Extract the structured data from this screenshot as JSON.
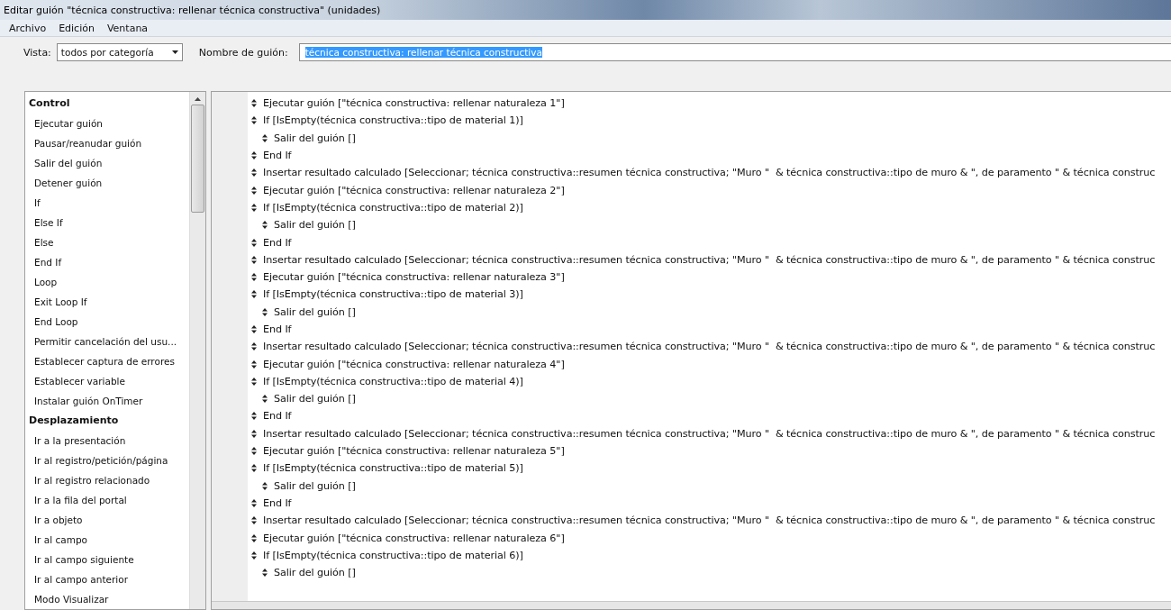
{
  "window": {
    "title": "Editar guión \"técnica constructiva: rellenar técnica constructiva\" (unidades)"
  },
  "menu": [
    "Archivo",
    "Edición",
    "Ventana"
  ],
  "view": {
    "label": "Vista:",
    "value": "todos por categoría"
  },
  "script_name": {
    "label": "Nombre de guión:",
    "value": "técnica constructiva: rellenar técnica constructiva",
    "selected": true
  },
  "steps_list": [
    {
      "label": "Control",
      "children": [
        {
          "label": "Ejecutar guión"
        },
        {
          "label": "Pausar/reanudar guión"
        },
        {
          "label": "Salir del guión"
        },
        {
          "label": "Detener guión"
        },
        {
          "label": "If"
        },
        {
          "label": "Else If"
        },
        {
          "label": "Else"
        },
        {
          "label": "End If"
        },
        {
          "label": "Loop"
        },
        {
          "label": "Exit Loop If"
        },
        {
          "label": "End Loop"
        },
        {
          "label": "Permitir cancelación del usu..."
        },
        {
          "label": "Establecer captura de errores"
        },
        {
          "label": "Establecer variable"
        },
        {
          "label": "Instalar guión OnTimer"
        }
      ]
    },
    {
      "label": "Desplazamiento",
      "children": [
        {
          "label": "Ir a la presentación"
        },
        {
          "label": "Ir al registro/petición/página"
        },
        {
          "label": "Ir al registro relacionado"
        },
        {
          "label": "Ir a la fila del portal"
        },
        {
          "label": "Ir a objeto"
        },
        {
          "label": "Ir al campo"
        },
        {
          "label": "Ir al campo siguiente"
        },
        {
          "label": "Ir al campo anterior"
        },
        {
          "label": "Modo Visualizar"
        }
      ]
    }
  ],
  "script": [
    {
      "text": "Ejecutar guión [\"técnica constructiva: rellenar naturaleza 1\"]"
    },
    {
      "text": "If [IsEmpty(técnica constructiva::tipo de material 1)]",
      "children": [
        {
          "text": "Salir del guión []"
        }
      ]
    },
    {
      "text": "End If"
    },
    {
      "text": "Insertar resultado calculado [Seleccionar; técnica constructiva::resumen técnica constructiva; \"Muro \"  & técnica constructiva::tipo de muro & \", de paramento \" & técnica construc"
    },
    {
      "text": "Ejecutar guión [\"técnica constructiva: rellenar naturaleza 2\"]"
    },
    {
      "text": "If [IsEmpty(técnica constructiva::tipo de material 2)]",
      "children": [
        {
          "text": "Salir del guión []"
        }
      ]
    },
    {
      "text": "End If"
    },
    {
      "text": "Insertar resultado calculado [Seleccionar; técnica constructiva::resumen técnica constructiva; \"Muro \"  & técnica constructiva::tipo de muro & \", de paramento \" & técnica construc"
    },
    {
      "text": "Ejecutar guión [\"técnica constructiva: rellenar naturaleza 3\"]"
    },
    {
      "text": "If [IsEmpty(técnica constructiva::tipo de material 3)]",
      "children": [
        {
          "text": "Salir del guión []"
        }
      ]
    },
    {
      "text": "End If"
    },
    {
      "text": "Insertar resultado calculado [Seleccionar; técnica constructiva::resumen técnica constructiva; \"Muro \"  & técnica constructiva::tipo de muro & \", de paramento \" & técnica construc"
    },
    {
      "text": "Ejecutar guión [\"técnica constructiva: rellenar naturaleza 4\"]"
    },
    {
      "text": "If [IsEmpty(técnica constructiva::tipo de material 4)]",
      "children": [
        {
          "text": "Salir del guión []"
        }
      ]
    },
    {
      "text": "End If"
    },
    {
      "text": "Insertar resultado calculado [Seleccionar; técnica constructiva::resumen técnica constructiva; \"Muro \"  & técnica constructiva::tipo de muro & \", de paramento \" & técnica construc"
    },
    {
      "text": "Ejecutar guión [\"técnica constructiva: rellenar naturaleza 5\"]"
    },
    {
      "text": "If [IsEmpty(técnica constructiva::tipo de material 5)]",
      "children": [
        {
          "text": "Salir del guión []"
        }
      ]
    },
    {
      "text": "End If"
    },
    {
      "text": "Insertar resultado calculado [Seleccionar; técnica constructiva::resumen técnica constructiva; \"Muro \"  & técnica constructiva::tipo de muro & \", de paramento \" & técnica construc"
    },
    {
      "text": "Ejecutar guión [\"técnica constructiva: rellenar naturaleza 6\"]"
    },
    {
      "text": "If [IsEmpty(técnica constructiva::tipo de material 6)]",
      "children": [
        {
          "text": "Salir del guión []"
        }
      ]
    }
  ]
}
